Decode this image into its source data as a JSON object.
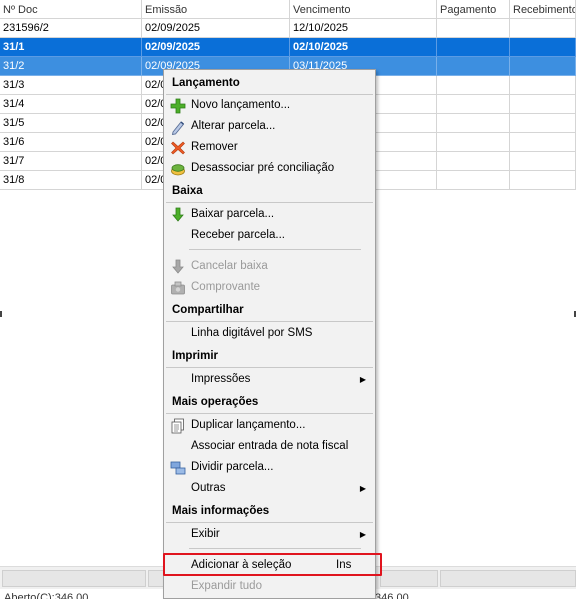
{
  "grid": {
    "columns": [
      "Nº Doc",
      "Emissão",
      "Vencimento",
      "Pagamento",
      "Recebimento"
    ],
    "rows": [
      {
        "doc": "231596/2",
        "emissao": "02/09/2025",
        "vencimento": "12/10/2025",
        "pagamento": "",
        "recebimento": ""
      },
      {
        "doc": "31/1",
        "emissao": "02/09/2025",
        "vencimento": "02/10/2025",
        "pagamento": "",
        "recebimento": ""
      },
      {
        "doc": "31/2",
        "emissao": "02/09/2025",
        "vencimento": "03/11/2025",
        "pagamento": "",
        "recebimento": ""
      },
      {
        "doc": "31/3",
        "emissao": "02/0",
        "vencimento": "",
        "pagamento": "",
        "recebimento": ""
      },
      {
        "doc": "31/4",
        "emissao": "02/0",
        "vencimento": "",
        "pagamento": "",
        "recebimento": ""
      },
      {
        "doc": "31/5",
        "emissao": "02/0",
        "vencimento": "",
        "pagamento": "",
        "recebimento": ""
      },
      {
        "doc": "31/6",
        "emissao": "02/0",
        "vencimento": "",
        "pagamento": "",
        "recebimento": ""
      },
      {
        "doc": "31/7",
        "emissao": "02/0",
        "vencimento": "",
        "pagamento": "",
        "recebimento": ""
      },
      {
        "doc": "31/8",
        "emissao": "02/0",
        "vencimento": "",
        "pagamento": "",
        "recebimento": ""
      }
    ]
  },
  "footer": {
    "left_text": "Aberto(C):346,00",
    "right_text": ":346,00"
  },
  "menu": {
    "lancamento": {
      "header": "Lançamento",
      "novo": "Novo lançamento...",
      "alterar": "Alterar parcela...",
      "remover": "Remover",
      "desassociar": "Desassociar pré conciliação"
    },
    "baixa": {
      "header": "Baixa",
      "baixar": "Baixar parcela...",
      "receber": "Receber parcela...",
      "cancelar": "Cancelar baixa",
      "comprovante": "Comprovante"
    },
    "compartilhar": {
      "header": "Compartilhar",
      "linha": "Linha digitável por SMS"
    },
    "imprimir": {
      "header": "Imprimir",
      "impressoes": "Impressões"
    },
    "mais_operacoes": {
      "header": "Mais operações",
      "duplicar": "Duplicar lançamento...",
      "associar": "Associar entrada de nota fiscal",
      "dividir": "Dividir parcela...",
      "outras": "Outras"
    },
    "mais_informacoes": {
      "header": "Mais informações",
      "exibir": "Exibir",
      "adicionar": "Adicionar à seleção",
      "adicionar_shortcut": "Ins",
      "expandir": "Expandir tudo"
    }
  },
  "colors": {
    "selection_primary": "#0a6fd8",
    "selection_secondary": "#3d8fe0",
    "highlight_border": "#e0141e"
  }
}
